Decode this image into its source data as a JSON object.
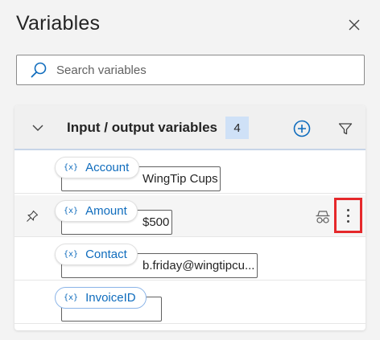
{
  "pane": {
    "title": "Variables",
    "close_icon": "close-icon"
  },
  "search": {
    "placeholder": "Search variables",
    "value": "",
    "icon": "search-icon"
  },
  "section": {
    "title": "Input / output variables",
    "count": "4",
    "icons": [
      "chevron-down-icon",
      "add-circle-icon",
      "filter-icon"
    ]
  },
  "variables": [
    {
      "prefix": "{x}",
      "name": "Account",
      "value": "WingTip Cups"
    },
    {
      "prefix": "{x}",
      "name": "Amount",
      "value": "$500",
      "pin_icon": "pin-icon",
      "spy_icon": "sensitive-incognito-icon",
      "more_icon": "more-vertical-icon"
    },
    {
      "prefix": "{x}",
      "name": "Contact",
      "value": "b.friday@wingtipcu..."
    },
    {
      "prefix": "{x}",
      "name": "InvoiceID",
      "value": ""
    }
  ],
  "colors": {
    "accent": "#0f6cbd",
    "badge_bg": "#cfe1f7",
    "highlight": "#e5282b"
  }
}
